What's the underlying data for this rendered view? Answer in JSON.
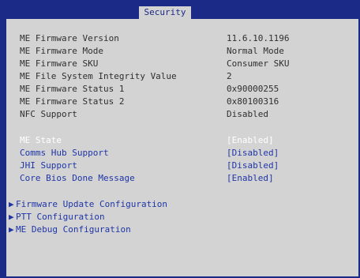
{
  "tabs": {
    "active": "Security"
  },
  "info": [
    {
      "label": "ME Firmware Version",
      "value": "11.6.10.1196"
    },
    {
      "label": "ME Firmware Mode",
      "value": "Normal Mode"
    },
    {
      "label": "ME Firmware SKU",
      "value": "Consumer SKU"
    },
    {
      "label": "ME File System Integrity Value",
      "value": "2"
    },
    {
      "label": "ME Firmware Status 1",
      "value": "0x90000255"
    },
    {
      "label": "ME Firmware Status 2",
      "value": "0x80100316"
    },
    {
      "label": "NFC Support",
      "value": "Disabled"
    }
  ],
  "options": [
    {
      "label": "ME State",
      "value": "[Enabled]"
    },
    {
      "label": "Comms Hub Support",
      "value": "[Disabled]"
    },
    {
      "label": "JHI Support",
      "value": "[Disabled]"
    },
    {
      "label": "Core Bios Done Message",
      "value": "[Enabled]"
    }
  ],
  "submenus": [
    {
      "arrow": "▶",
      "label": "Firmware Update Configuration"
    },
    {
      "arrow": "▶",
      "label": "PTT Configuration"
    },
    {
      "arrow": "▶",
      "label": "ME Debug Configuration"
    }
  ]
}
